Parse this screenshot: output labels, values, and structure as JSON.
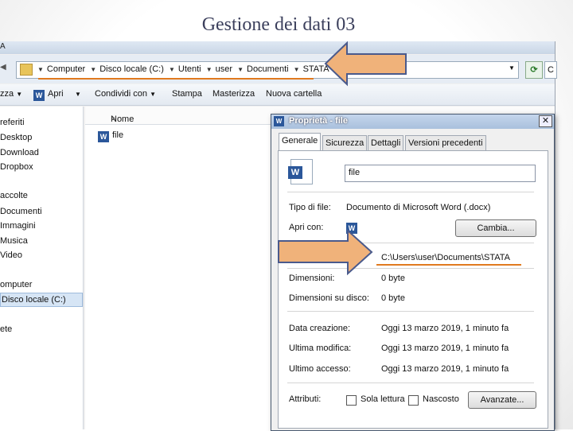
{
  "slide": {
    "title": "Gestione dei dati 03"
  },
  "window": {
    "title_fragment": "A"
  },
  "address": {
    "crumbs": [
      "Computer",
      "Disco locale (C:)",
      "Utenti",
      "user",
      "Documenti",
      "STATA"
    ],
    "search_fragment": "C"
  },
  "toolbar": {
    "organize_fragment": "zza",
    "open_label": "Apri",
    "share_label": "Condividi con",
    "print_label": "Stampa",
    "burn_label": "Masterizza",
    "new_folder_label": "Nuova cartella"
  },
  "nav": {
    "favorites": "referiti",
    "items_fav": [
      "Desktop",
      "Download",
      "Dropbox"
    ],
    "libraries": "accolte",
    "items_lib": [
      "Documenti",
      "Immagini",
      "Musica",
      "Video"
    ],
    "computer": "omputer",
    "disk": "Disco locale (C:)",
    "network": "ete"
  },
  "files": {
    "column_name": "Nome",
    "rows": [
      "file"
    ]
  },
  "dialog": {
    "title": "Proprietà - file",
    "tabs": [
      "Generale",
      "Sicurezza",
      "Dettagli",
      "Versioni precedenti"
    ],
    "filename": "file",
    "type_label": "Tipo di file:",
    "type_value": "Documento di Microsoft Word (.docx)",
    "opens_label": "Apri con:",
    "change_button": "Cambia...",
    "path_value": "C:\\Users\\user\\Documents\\STATA",
    "size_label": "Dimensioni:",
    "size_value": "0 byte",
    "disk_size_label": "Dimensioni su disco:",
    "disk_size_value": "0 byte",
    "created_label": "Data creazione:",
    "created_value": "Oggi 13 marzo 2019, 1 minuto fa",
    "modified_label": "Ultima modifica:",
    "modified_value": "Oggi 13 marzo 2019, 1 minuto fa",
    "accessed_label": "Ultimo accesso:",
    "accessed_value": "Oggi 13 marzo 2019, 1 minuto fa",
    "attributes_label": "Attributi:",
    "readonly_label": "Sola lettura",
    "hidden_label": "Nascosto",
    "advanced_button": "Avanzate..."
  },
  "colors": {
    "arrow_fill": "#f0b27a",
    "arrow_stroke": "#4a5a8c",
    "highlight": "#e07a1f"
  }
}
